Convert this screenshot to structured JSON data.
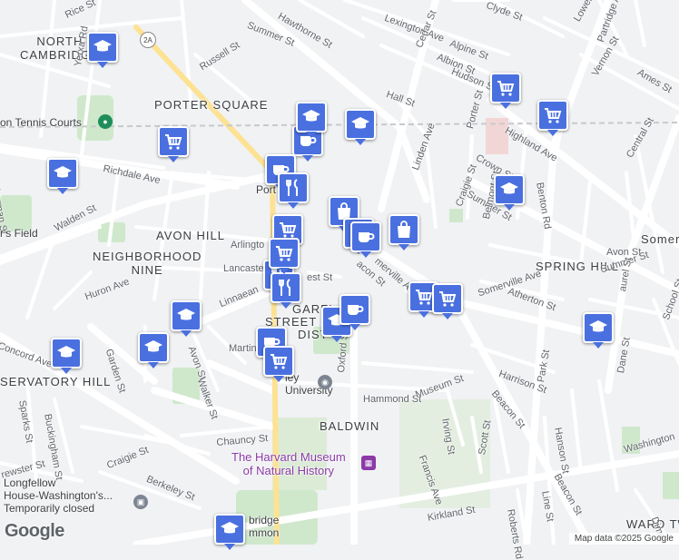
{
  "map": {
    "neighborhoods": [
      {
        "id": "north-cambridge",
        "text": "NORTH\nCAMBRIDGE"
      },
      {
        "id": "porter-square",
        "text": "PORTER SQUARE"
      },
      {
        "id": "avon-hill",
        "text": "AVON HILL"
      },
      {
        "id": "neighborhood-nine",
        "text": "NEIGHBORHOOD\nNINE"
      },
      {
        "id": "spring-hill",
        "text": "SPRING HILL"
      },
      {
        "id": "observatory-hill",
        "text": "SERVATORY HILL"
      },
      {
        "id": "baldwin",
        "text": "BALDWIN"
      },
      {
        "id": "ward-two",
        "text": "WARD TW"
      },
      {
        "id": "garfield",
        "text": "GARFI"
      },
      {
        "id": "street-hist",
        "text": "STREET"
      },
      {
        "id": "district",
        "text": "DIST"
      },
      {
        "id": "somerville-partial",
        "text": "Somer"
      }
    ],
    "streets": [
      {
        "id": "summer-st-1",
        "text": "Summer St"
      },
      {
        "id": "hawthorne-st",
        "text": "Hawthorne St"
      },
      {
        "id": "lexington-ave",
        "text": "Lexington Ave"
      },
      {
        "id": "alpine-st",
        "text": "Alpine St"
      },
      {
        "id": "albion-st",
        "text": "Albion St"
      },
      {
        "id": "hudson-st",
        "text": "Hudson St"
      },
      {
        "id": "cedar-st",
        "text": "Cedar St"
      },
      {
        "id": "lowell-st",
        "text": "Lowell St"
      },
      {
        "id": "clyde-st",
        "text": "Clyde St"
      },
      {
        "id": "rice-st",
        "text": "Rice St"
      },
      {
        "id": "russell-st",
        "text": "Russell St"
      },
      {
        "id": "yerxa-rd",
        "text": "Yerxa Rd"
      },
      {
        "id": "hall-st",
        "text": "Hall St"
      },
      {
        "id": "highland-ave",
        "text": "Highland Ave"
      },
      {
        "id": "porter-st",
        "text": "Porter St"
      },
      {
        "id": "crown-st",
        "text": "Crown St"
      },
      {
        "id": "linden-ave",
        "text": "Linden Ave"
      },
      {
        "id": "summer-st-2",
        "text": "Summer St"
      },
      {
        "id": "central-st",
        "text": "Central St"
      },
      {
        "id": "vernon-st",
        "text": "Vernon St"
      },
      {
        "id": "ames-st",
        "text": "Ames St"
      },
      {
        "id": "partridge-ave",
        "text": "Partridge Ave"
      },
      {
        "id": "richdale-ave",
        "text": "Richdale Ave"
      },
      {
        "id": "sherman-st",
        "text": "Sherman St"
      },
      {
        "id": "walden-st",
        "text": "Walden St"
      },
      {
        "id": "arlington",
        "text": "Arlingto"
      },
      {
        "id": "lancaster",
        "text": "Lancaste"
      },
      {
        "id": "forest-st",
        "text": "est St"
      },
      {
        "id": "craigie-st",
        "text": "Craigie St"
      },
      {
        "id": "benton-rd",
        "text": "Benton Rd"
      },
      {
        "id": "belmont-st",
        "text": "Belmont St"
      },
      {
        "id": "avon-st",
        "text": "Avon St"
      },
      {
        "id": "summer-st-3",
        "text": "Summer St"
      },
      {
        "id": "laurel-st",
        "text": "aurel St"
      },
      {
        "id": "atherton-st",
        "text": "Atherton St"
      },
      {
        "id": "somerville-ave",
        "text": "Somerville Ave"
      },
      {
        "id": "somerville-ave-2",
        "text": "merville Ave"
      },
      {
        "id": "beacon-st",
        "text": "acon St"
      },
      {
        "id": "huron-ave",
        "text": "Huron Ave"
      },
      {
        "id": "linnaean-st",
        "text": "Linnaean"
      },
      {
        "id": "concord-ave",
        "text": "Concord Ave"
      },
      {
        "id": "garden-st",
        "text": "Garden St"
      },
      {
        "id": "avon-st-2",
        "text": "Avon St"
      },
      {
        "id": "walker-st",
        "text": "Walker St"
      },
      {
        "id": "martin-st",
        "text": "Martin"
      },
      {
        "id": "oxford-st",
        "text": "Oxford St"
      },
      {
        "id": "hammond-st",
        "text": "Hammond St"
      },
      {
        "id": "museum-st",
        "text": "Museum St"
      },
      {
        "id": "harrison-st",
        "text": "Harrison St"
      },
      {
        "id": "beacon-st-2",
        "text": "Beacon St"
      },
      {
        "id": "park-st",
        "text": "Park St"
      },
      {
        "id": "dane-st",
        "text": "Dane St"
      },
      {
        "id": "washington",
        "text": "Washington"
      },
      {
        "id": "hanson-st",
        "text": "Hanson St"
      },
      {
        "id": "irving-st",
        "text": "Irving St"
      },
      {
        "id": "francis-ave",
        "text": "Francis Ave"
      },
      {
        "id": "scott-st",
        "text": "Scott St"
      },
      {
        "id": "chauncy-st",
        "text": "Chauncy St"
      },
      {
        "id": "craigie-st-2",
        "text": "Craigie St"
      },
      {
        "id": "berkeley-st",
        "text": "Berkeley St"
      },
      {
        "id": "sparks-st",
        "text": "Sparks St"
      },
      {
        "id": "buckingham-st",
        "text": "Buckingham St"
      },
      {
        "id": "brewster-st",
        "text": "rewster St"
      },
      {
        "id": "kirkland-st",
        "text": "Kirkland St"
      },
      {
        "id": "roberts-rd",
        "text": "Roberts Rd"
      },
      {
        "id": "line-st",
        "text": "Line St"
      },
      {
        "id": "beacon-st-3",
        "text": "Beacon St"
      },
      {
        "id": "school-st",
        "text": "School St"
      },
      {
        "id": "dimick",
        "text": "Dimic"
      }
    ],
    "pois": [
      {
        "id": "tennis-courts",
        "text": "on Tennis Courts"
      },
      {
        "id": "lesley-university",
        "text": "ley\nUniversity"
      },
      {
        "id": "longfellow-house",
        "text": "Longfellow\nHouse-Washington's...\nTemporarily closed"
      },
      {
        "id": "cambridge-common",
        "text": "bridge\nmmon"
      },
      {
        "id": "porter-partial",
        "text": "Port"
      },
      {
        "id": "rs-field",
        "text": "r's Field"
      }
    ],
    "museum": {
      "text": "The Harvard Museum\nof Natural History"
    },
    "route_badge": "2A",
    "markers": [
      {
        "type": "school"
      },
      {
        "type": "grocery"
      },
      {
        "type": "school"
      },
      {
        "type": "cafe"
      },
      {
        "type": "school"
      },
      {
        "type": "grocery"
      },
      {
        "type": "grocery"
      },
      {
        "type": "grocery"
      },
      {
        "type": "school"
      },
      {
        "type": "school"
      },
      {
        "type": "cafe"
      },
      {
        "type": "restaurant"
      },
      {
        "type": "shopping"
      },
      {
        "type": "shopping"
      },
      {
        "type": "shopping"
      },
      {
        "type": "cafe"
      },
      {
        "type": "restaurant"
      },
      {
        "type": "grocery"
      },
      {
        "type": "restaurant"
      },
      {
        "type": "school"
      },
      {
        "type": "school"
      },
      {
        "type": "school"
      },
      {
        "type": "school"
      },
      {
        "type": "cafe"
      },
      {
        "type": "cafe"
      },
      {
        "type": "grocery"
      },
      {
        "type": "grocery"
      },
      {
        "type": "grocery"
      },
      {
        "type": "school"
      },
      {
        "type": "school"
      }
    ]
  },
  "footer": {
    "logo": "Google",
    "attribution": "Map data ©2025 Google"
  },
  "colors": {
    "marker": "#4a70e0",
    "park": "#cfe8cc",
    "major_road": "#ffffff",
    "highway": "#fde293",
    "background": "#f1f2f4",
    "museum_text": "#8b3aa8"
  }
}
